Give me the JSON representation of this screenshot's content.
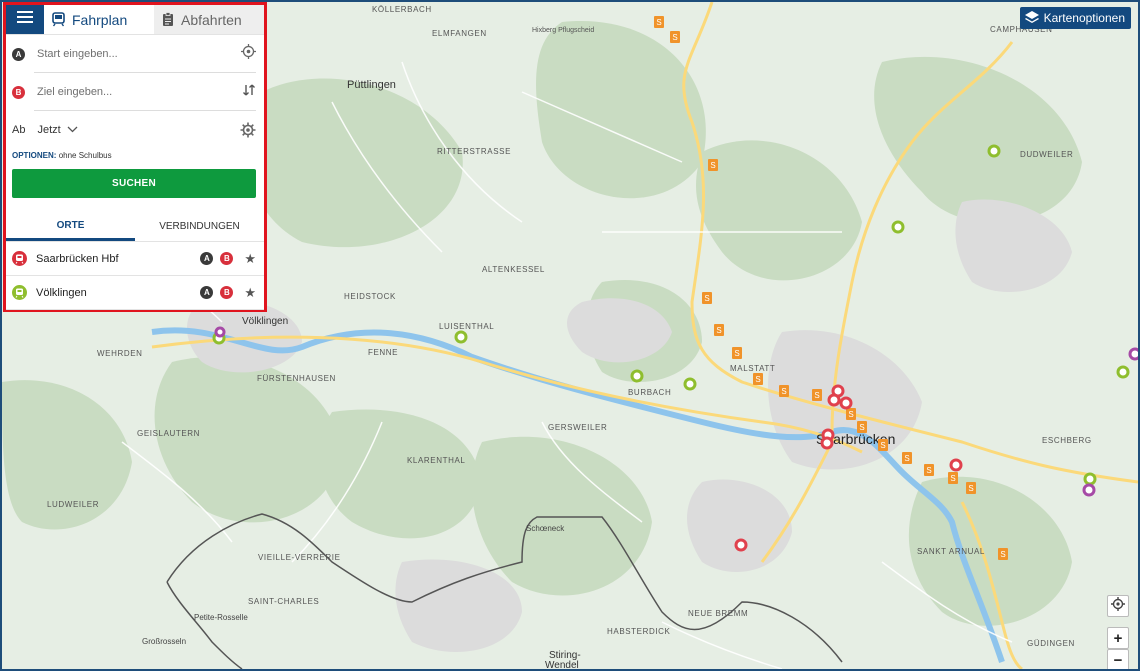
{
  "panel": {
    "tabs": [
      {
        "label": "Fahrplan",
        "icon": "train-icon"
      },
      {
        "label": "Abfahrten",
        "icon": "clipboard-icon"
      }
    ],
    "start": {
      "badge": "A",
      "placeholder": "Start eingeben..."
    },
    "ziel": {
      "badge": "B",
      "placeholder": "Ziel eingeben..."
    },
    "time": {
      "prefix": "Ab",
      "value": "Jetzt"
    },
    "options": {
      "key": "OPTIONEN:",
      "value": "ohne Schulbus"
    },
    "search_label": "SUCHEN",
    "subtabs": [
      {
        "label": "ORTE",
        "active": true
      },
      {
        "label": "VERBINDUNGEN",
        "active": false
      }
    ],
    "places": [
      {
        "name": "Saarbrücken Hbf",
        "color": "#d8303c",
        "a": "A",
        "b": "B"
      },
      {
        "name": "Völklingen",
        "color": "#8fbe2e",
        "a": "A",
        "b": "B"
      }
    ]
  },
  "map": {
    "options_label": "Kartenoptionen",
    "labels": {
      "puttlingen": "Püttlingen",
      "volklingen": "Völklingen",
      "saarbrucken": "Saarbrücken",
      "stiring1": "Stiring-",
      "stiring2": "Wendel",
      "grossrosseln": "Großrosseln",
      "petite": "Petite-Rosselle",
      "schoeneck": "Schœneck",
      "kollerbach": "KÖLLERBACH",
      "elmfangen": "ELMFANGEN",
      "ritter": "RITTERSTRASSE",
      "heidstock": "HEIDSTOCK",
      "altenkessel": "ALTENKESSEL",
      "luisenthal": "LUISENTHAL",
      "wehrden": "WEHRDEN",
      "fenne": "FENNE",
      "fursten": "FÜRSTENHAUSEN",
      "geislautern": "GEISLAUTERN",
      "ludweiler": "LUDWEILER",
      "klarenthal": "KLARENTHAL",
      "gersweiler": "GERSWEILER",
      "burbach": "BURBACH",
      "malstatt": "MALSTATT",
      "dudweiler": "DUDWEILER",
      "camphausen": "CAMPHAUSEN",
      "eschberg": "ESCHBERG",
      "sanktarnual": "SANKT ARNUAL",
      "gudingen": "GÜDINGEN",
      "neuebremm": "NEUE BREMM",
      "habsterdick": "HABSTERDICK",
      "vieille": "VIEILLE-VERRERIE",
      "saintcharles": "SAINT-CHARLES",
      "hixberg": "Hixberg Pflugscheid"
    },
    "zoom_in": "+",
    "zoom_out": "−"
  }
}
